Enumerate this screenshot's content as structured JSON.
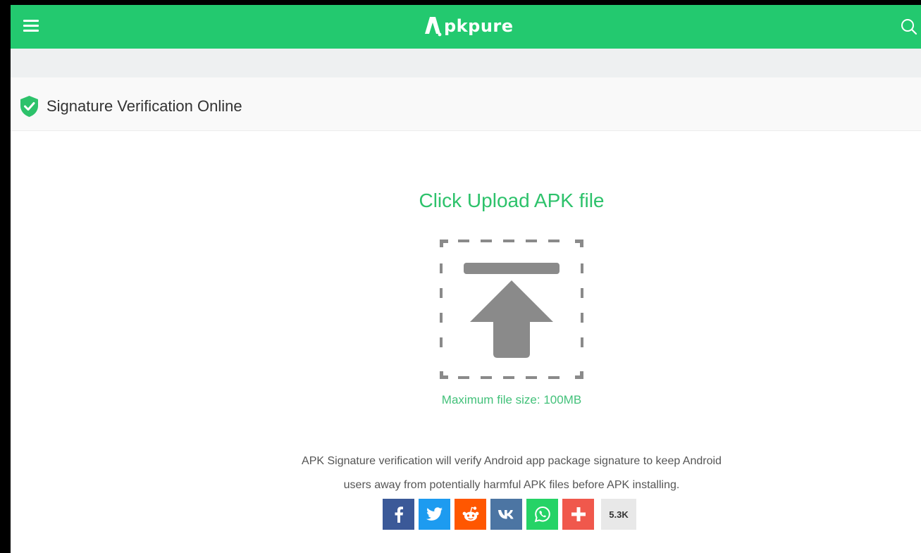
{
  "header": {
    "logo_text": "pkpure",
    "menu_icon": "hamburger-menu-icon",
    "search_icon": "search-icon",
    "brand_color": "#23c96f"
  },
  "page": {
    "title": "Signature Verification Online",
    "title_icon": "shield-check-icon"
  },
  "upload": {
    "heading": "Click Upload APK file",
    "icon": "upload-arrow-icon",
    "max_size": "Maximum file size: 100MB"
  },
  "description": {
    "line1": "APK Signature verification will verify Android app package signature to keep Android",
    "line2": "users away from potentially harmful APK files before APK installing."
  },
  "share": {
    "buttons": [
      {
        "name": "facebook",
        "icon": "facebook-icon",
        "color": "#3b5998"
      },
      {
        "name": "twitter",
        "icon": "twitter-icon",
        "color": "#1d9bf0"
      },
      {
        "name": "reddit",
        "icon": "reddit-icon",
        "color": "#ff5700"
      },
      {
        "name": "vk",
        "icon": "vk-icon",
        "color": "#4c75a3"
      },
      {
        "name": "whatsapp",
        "icon": "whatsapp-icon",
        "color": "#25d366"
      },
      {
        "name": "more",
        "icon": "plus-icon",
        "color": "#f0584c"
      }
    ],
    "count": "5.3K"
  }
}
